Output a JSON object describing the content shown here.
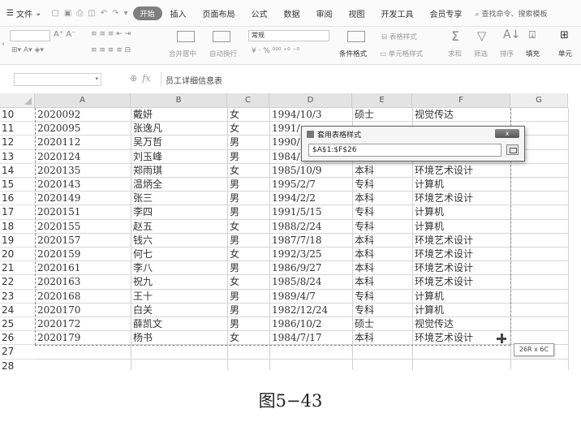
{
  "menubar": {
    "file_menu": "文件",
    "tabs": [
      "开始",
      "插入",
      "页面布局",
      "公式",
      "数据",
      "审阅",
      "视图",
      "开发工具",
      "会员专享"
    ],
    "search": "查找命令、搜索模板"
  },
  "ribbon": {
    "number_format": "常规",
    "merge_label": "合并居中",
    "wrap_label": "自动换行",
    "number_symbols": "¥ · % ⁰⁰⁰ ⁺⁰ ⁻⁰",
    "table_style_label": "表格样式",
    "cond_format_label": "条件格式",
    "cell_style_label": "单元格样式",
    "sum_label": "求和",
    "filter_label": "筛选",
    "sort_label": "排序",
    "fill_label": "填充",
    "single_label": "单元"
  },
  "formula_bar": {
    "name_box": "",
    "fx": "fx",
    "content": "员工详细信息表"
  },
  "columns": [
    "A",
    "B",
    "C",
    "D",
    "E",
    "F",
    "G"
  ],
  "rows": [
    {
      "num": "10",
      "cells": [
        "2020092",
        "戴妍",
        "女",
        "1994/10/3",
        "硕士",
        "视觉传达"
      ]
    },
    {
      "num": "11",
      "cells": [
        "2020095",
        "张逸凡",
        "女",
        "1991/",
        "",
        ""
      ]
    },
    {
      "num": "12",
      "cells": [
        "2020112",
        "吴万哲",
        "男",
        "1990/",
        "",
        ""
      ]
    },
    {
      "num": "13",
      "cells": [
        "2020124",
        "刘玉峰",
        "男",
        "1984/",
        "",
        ""
      ]
    },
    {
      "num": "14",
      "cells": [
        "2020135",
        "郑雨琪",
        "女",
        "1985/10/9",
        "本科",
        "环境艺术设计"
      ]
    },
    {
      "num": "15",
      "cells": [
        "2020143",
        "温炳全",
        "男",
        "1995/2/7",
        "专科",
        "计算机"
      ]
    },
    {
      "num": "16",
      "cells": [
        "2020149",
        "张三",
        "男",
        "1994/2/2",
        "本科",
        "环境艺术设计"
      ]
    },
    {
      "num": "17",
      "cells": [
        "2020151",
        "李四",
        "男",
        "1991/5/15",
        "专科",
        "计算机"
      ]
    },
    {
      "num": "18",
      "cells": [
        "2020155",
        "赵五",
        "女",
        "1988/2/24",
        "专科",
        "计算机"
      ]
    },
    {
      "num": "19",
      "cells": [
        "2020157",
        "钱六",
        "男",
        "1987/7/18",
        "本科",
        "环境艺术设计"
      ]
    },
    {
      "num": "20",
      "cells": [
        "2020159",
        "何七",
        "女",
        "1992/3/25",
        "本科",
        "环境艺术设计"
      ]
    },
    {
      "num": "21",
      "cells": [
        "2020161",
        "李八",
        "男",
        "1986/9/27",
        "本科",
        "环境艺术设计"
      ]
    },
    {
      "num": "22",
      "cells": [
        "2020163",
        "祝九",
        "女",
        "1985/8/24",
        "本科",
        "环境艺术设计"
      ]
    },
    {
      "num": "23",
      "cells": [
        "2020168",
        "王十",
        "男",
        "1989/4/7",
        "专科",
        "计算机"
      ]
    },
    {
      "num": "24",
      "cells": [
        "2020170",
        "白关",
        "男",
        "1982/12/24",
        "专科",
        "计算机"
      ]
    },
    {
      "num": "25",
      "cells": [
        "2020172",
        "薛凯文",
        "男",
        "1986/10/2",
        "硕士",
        "视觉传达"
      ]
    },
    {
      "num": "26",
      "cells": [
        "2020179",
        "杨书",
        "女",
        "1984/7/17",
        "本科",
        "环境艺术设计"
      ]
    },
    {
      "num": "27",
      "cells": [
        "",
        "",
        "",
        "",
        "",
        ""
      ]
    },
    {
      "num": "28",
      "cells": [
        "",
        "",
        "",
        "",
        "",
        ""
      ]
    }
  ],
  "dialog": {
    "title": "套用表格样式",
    "close": "x",
    "range": "$A$1:$F$26"
  },
  "selection_tip": "26R x 6C",
  "caption": "图5−43",
  "colors": {
    "accent": "#7f7f7f",
    "grid": "#d0d0d0",
    "header_bg": "#eeeeee"
  }
}
